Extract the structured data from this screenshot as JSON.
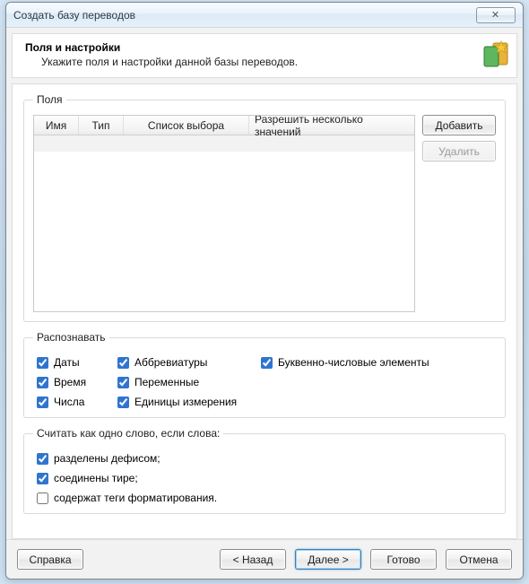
{
  "window": {
    "title": "Создать базу переводов",
    "close_glyph": "✕"
  },
  "header": {
    "title": "Поля и настройки",
    "subtitle": "Укажите поля и настройки данной базы переводов."
  },
  "groups": {
    "fields_legend": "Поля",
    "recognize_legend": "Распознавать",
    "oneword_legend": "Считать как одно слово, если слова:"
  },
  "table": {
    "columns": {
      "name": "Имя",
      "type": "Тип",
      "list": "Список выбора",
      "multi": "Разрешить несколько значений"
    }
  },
  "buttons": {
    "add": "Добавить",
    "delete": "Удалить",
    "help": "Справка",
    "back": "< Назад",
    "next": "Далее >",
    "finish": "Готово",
    "cancel": "Отмена"
  },
  "recognize": {
    "dates": "Даты",
    "times": "Время",
    "numbers": "Числа",
    "acronyms": "Аббревиатуры",
    "variables": "Переменные",
    "units": "Единицы измерения",
    "alnum": "Буквенно-числовые элементы"
  },
  "oneword": {
    "hyphen": "разделены дефисом;",
    "dash": "соединены тире;",
    "tags": "содержат теги форматирования."
  },
  "recognize_checked": {
    "dates": true,
    "times": true,
    "numbers": true,
    "acronyms": true,
    "variables": true,
    "units": true,
    "alnum": true
  },
  "oneword_checked": {
    "hyphen": true,
    "dash": true,
    "tags": false
  }
}
